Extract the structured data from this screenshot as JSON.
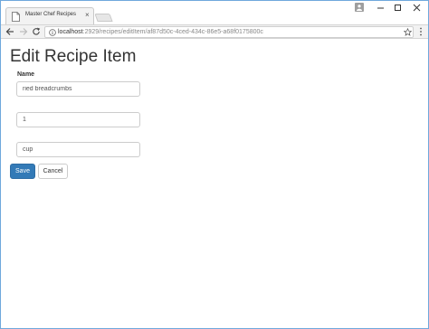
{
  "browser": {
    "tab_title": "Master Chef Recipes",
    "tab_close": "×",
    "url_host": "localhost",
    "url_rest": ":2929/recipes/editItem/af87d50c-4ced-434c-86e5-a68f0175800c"
  },
  "page": {
    "title": "Edit Recipe Item",
    "name_label": "Name",
    "fields": {
      "name_value": "ried breadcrumbs",
      "quantity_value": "1",
      "unit_value": "cup"
    },
    "save_label": "Save",
    "cancel_label": "Cancel"
  },
  "colors": {
    "primary": "#337ab7",
    "window_border": "#6fa8dc"
  }
}
